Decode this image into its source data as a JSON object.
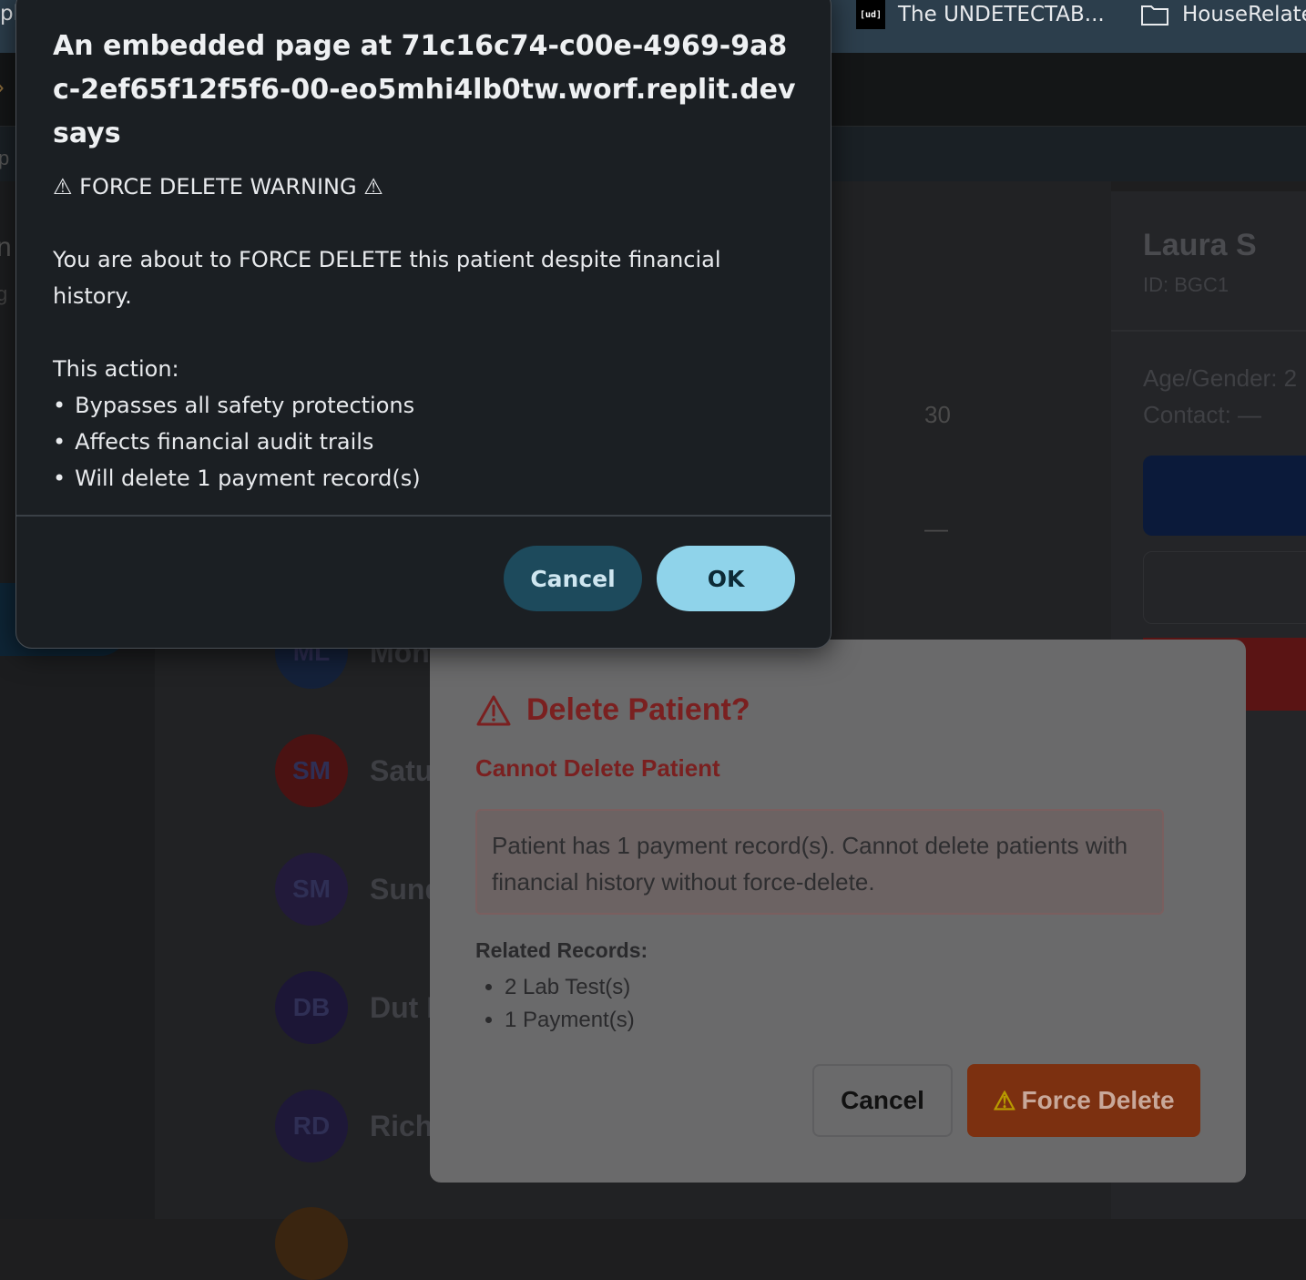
{
  "bookmarks": {
    "left_fragment": "pl",
    "undetectable_badge": "[ud]",
    "undetectable_label": "The UNDETECTAB...",
    "house_label": "HouseRelate"
  },
  "background": {
    "sub_bar_fragment": "p",
    "left_fragment": "n",
    "left_fragment2": "g",
    "column_value": "30",
    "column_dash": "—",
    "patient_panel": {
      "name": "Laura S",
      "id": "ID: BGC1",
      "age_gender": "Age/Gender: 2",
      "contact": "Contact: —"
    },
    "patients": [
      {
        "initials": "ML",
        "name": "Mon",
        "avatar_color": "#14213a"
      },
      {
        "initials": "SM",
        "name": "Satu",
        "avatar_color": "#4a1212"
      },
      {
        "initials": "SM",
        "name": "Sund",
        "avatar_color": "#221a3a"
      },
      {
        "initials": "DB",
        "name": "Dut E",
        "avatar_color": "#1c1636"
      },
      {
        "initials": "RD",
        "name": "Rich",
        "avatar_color": "#1e1838"
      }
    ]
  },
  "delete_modal": {
    "title": "Delete Patient?",
    "subtitle": "Cannot Delete Patient",
    "alert": "Patient has 1 payment record(s). Cannot delete patients with financial history without force-delete.",
    "related_label": "Related Records:",
    "related_items": [
      "2 Lab Test(s)",
      "1 Payment(s)"
    ],
    "cancel_label": "Cancel",
    "force_icon": "⚠",
    "force_label": "Force Delete"
  },
  "confirm_dialog": {
    "title": "An embedded page at 71c16c74-c00e-4969-9a8c-2ef65f12f5f6-00-eo5mhi4lb0tw.worf.replit.dev says",
    "warning": "⚠ FORCE DELETE WARNING ⚠",
    "message": "You are about to FORCE DELETE this patient despite financial history.",
    "action_header": "This action:",
    "bullets": [
      "Bypasses all safety protections",
      "Affects financial audit trails",
      "Will delete 1 payment record(s)"
    ],
    "bullet_symbol": "•",
    "cancel_label": "Cancel",
    "ok_label": "OK"
  }
}
